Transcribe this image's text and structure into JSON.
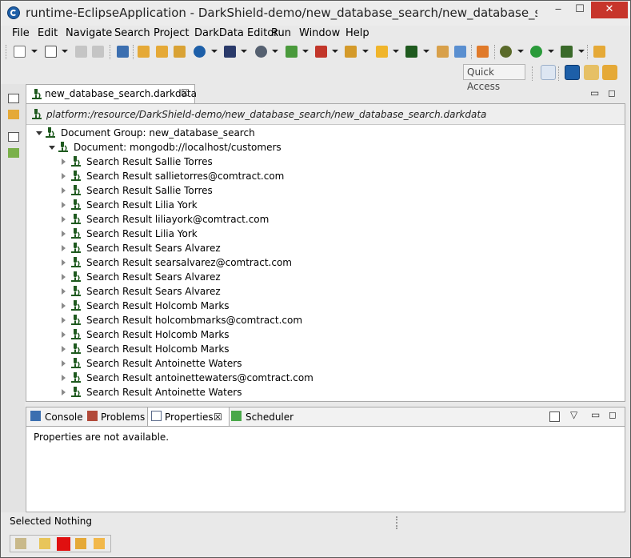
{
  "window": {
    "title": "runtime-EclipseApplication - DarkShield-demo/new_database_search/new_database_search.dark",
    "controls": {
      "minimize": "‒",
      "maximize": "☐",
      "close": "✕"
    }
  },
  "menu": [
    "File",
    "Edit",
    "Navigate",
    "Search",
    "Project",
    "DarkData Editor",
    "Run",
    "Window",
    "Help"
  ],
  "quick_access": {
    "placeholder": "Quick Access"
  },
  "editor": {
    "tab_label": "new_database_search.darkdata",
    "tab_close": "☒",
    "uri": "platform:/resource/DarkShield-demo/new_database_search/new_database_search.darkdata",
    "tree": {
      "group": "Document Group: new_database_search",
      "document": "Document: mongodb://localhost/customers",
      "results": [
        "Search Result Sallie Torres",
        "Search Result sallietorres@comtract.com",
        "Search Result Sallie Torres",
        "Search Result Lilia York",
        "Search Result liliayork@comtract.com",
        "Search Result Lilia York",
        "Search Result Sears Alvarez",
        "Search Result searsalvarez@comtract.com",
        "Search Result Sears Alvarez",
        "Search Result Sears Alvarez",
        "Search Result Holcomb Marks",
        "Search Result holcombmarks@comtract.com",
        "Search Result Holcomb Marks",
        "Search Result Holcomb Marks",
        "Search Result Antoinette Waters",
        "Search Result antoinettewaters@comtract.com",
        "Search Result Antoinette Waters"
      ]
    }
  },
  "bottom_panel": {
    "tabs": [
      "Console",
      "Problems",
      "Properties",
      "Scheduler"
    ],
    "active_tab": "Properties",
    "tab_close": "☒",
    "message": "Properties are not available."
  },
  "status": {
    "text": "Selected Nothing"
  },
  "colors": {
    "accent_blue": "#1d5fa8",
    "close_red": "#c7352b",
    "dark_green_icon": "#1f5a1f",
    "trim_red": "#e01010"
  }
}
